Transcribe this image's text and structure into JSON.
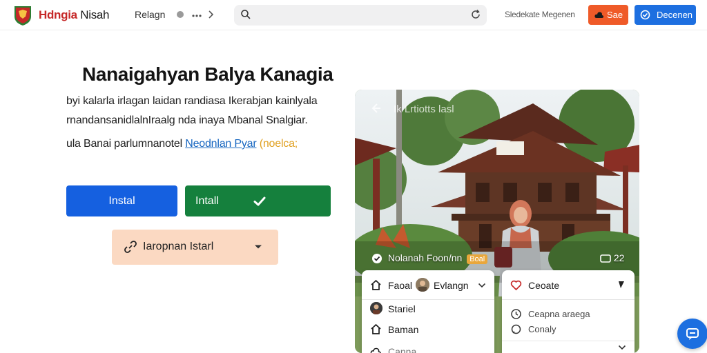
{
  "header": {
    "brand_part1": "Hdngia",
    "brand_part2": "Nisah",
    "nav_link": "Relagn",
    "right_text": "Sledekate Megenen",
    "orange_button": "Sae",
    "blue_button": "Decenen"
  },
  "main": {
    "title": "Nanaigahyan Balya Kanagia",
    "paragraph_line1": "byi kalarla irlagan laidan randiasa Ikerabjan kainlyala",
    "paragraph_line2": "rnandansanidlalnIraalg nda inaya Mbanal Snalgiar.",
    "paragraph_line3_prefix": "ula Banai parlumnanotel",
    "paragraph_link": "Neodnlan Pyar",
    "paragraph_note": "(noelca;",
    "install_blue": "Instal",
    "install_green": "Intall",
    "dropdown_label": "Iaropnan Istarl"
  },
  "photo": {
    "title": "Ik Lrtiotts lasl",
    "caption": "Nolanah Foon/nn",
    "caption_tag": "Boal",
    "count": "22"
  },
  "panel_a": {
    "header_item": "Faoal",
    "header_user": "Evlangn",
    "items": [
      "Stariel",
      "Baman",
      "Canna"
    ]
  },
  "panel_b": {
    "header_item": "Ceoate",
    "items": [
      "Ceapna araega",
      "Conaly"
    ]
  },
  "colors": {
    "brand_red": "#c62828",
    "orange": "#ef5a28",
    "blue": "#1d6fe0",
    "install_blue": "#1560e0",
    "install_green": "#15803d",
    "dropdown_bg": "#fbd9c2",
    "link": "#1565c0"
  },
  "icons": {
    "search": "search-icon",
    "refresh": "refresh-icon",
    "check": "check-icon",
    "link": "link-icon",
    "chevron": "chevron-down-icon",
    "heart": "heart-icon",
    "chat": "chat-icon"
  }
}
